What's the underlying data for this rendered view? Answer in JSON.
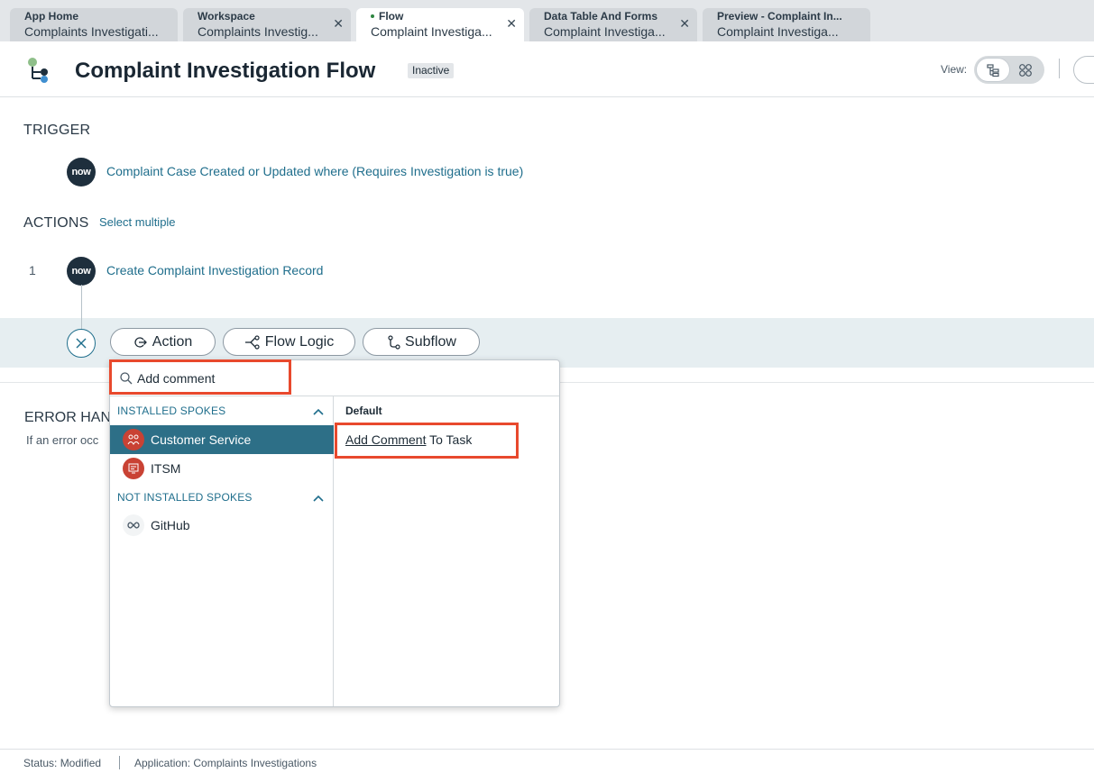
{
  "tabs": [
    {
      "title": "App Home",
      "subtitle": "Complaints Investigati...",
      "closable": false,
      "active": false
    },
    {
      "title": "Workspace",
      "subtitle": "Complaints Investig...",
      "closable": true,
      "active": false
    },
    {
      "title": "Flow",
      "subtitle": "Complaint Investiga...",
      "closable": true,
      "active": true
    },
    {
      "title": "Data Table And Forms",
      "subtitle": "Complaint Investiga...",
      "closable": true,
      "active": false
    },
    {
      "title": "Preview - Complaint In...",
      "subtitle": "Complaint Investiga...",
      "closable": false,
      "active": false
    }
  ],
  "header": {
    "title": "Complaint Investigation Flow",
    "status_badge": "Inactive",
    "view_label": "View:"
  },
  "trigger": {
    "section_title": "TRIGGER",
    "logo_text": "now",
    "description": "Complaint Case Created or Updated where (Requires Investigation is true)"
  },
  "actions": {
    "section_title": "ACTIONS",
    "select_multiple": "Select multiple",
    "items": [
      {
        "number": "1",
        "logo_text": "now",
        "label": "Create Complaint Investigation Record"
      }
    ]
  },
  "add_row": {
    "action_label": "Action",
    "flow_logic_label": "Flow Logic",
    "subflow_label": "Subflow"
  },
  "popup": {
    "search_value": "Add comment",
    "installed_header": "INSTALLED SPOKES",
    "not_installed_header": "NOT INSTALLED SPOKES",
    "installed": [
      {
        "label": "Customer Service",
        "selected": true
      },
      {
        "label": "ITSM",
        "selected": false
      }
    ],
    "not_installed": [
      {
        "label": "GitHub"
      }
    ],
    "results_header": "Default",
    "result_match": "Add Comment",
    "result_rest": " To Task"
  },
  "error_handler": {
    "title_partial": "ERROR HAND",
    "text_partial": "If an error occ"
  },
  "status_bar": {
    "status": "Status: Modified",
    "application": "Application: Complaints Investigations"
  },
  "colors": {
    "accent": "#1f6e8c",
    "selected_row": "#2d6f87",
    "highlight": "#e8492d",
    "spoke_red": "#c94234",
    "now_logo_bg": "#1e2f3d"
  }
}
